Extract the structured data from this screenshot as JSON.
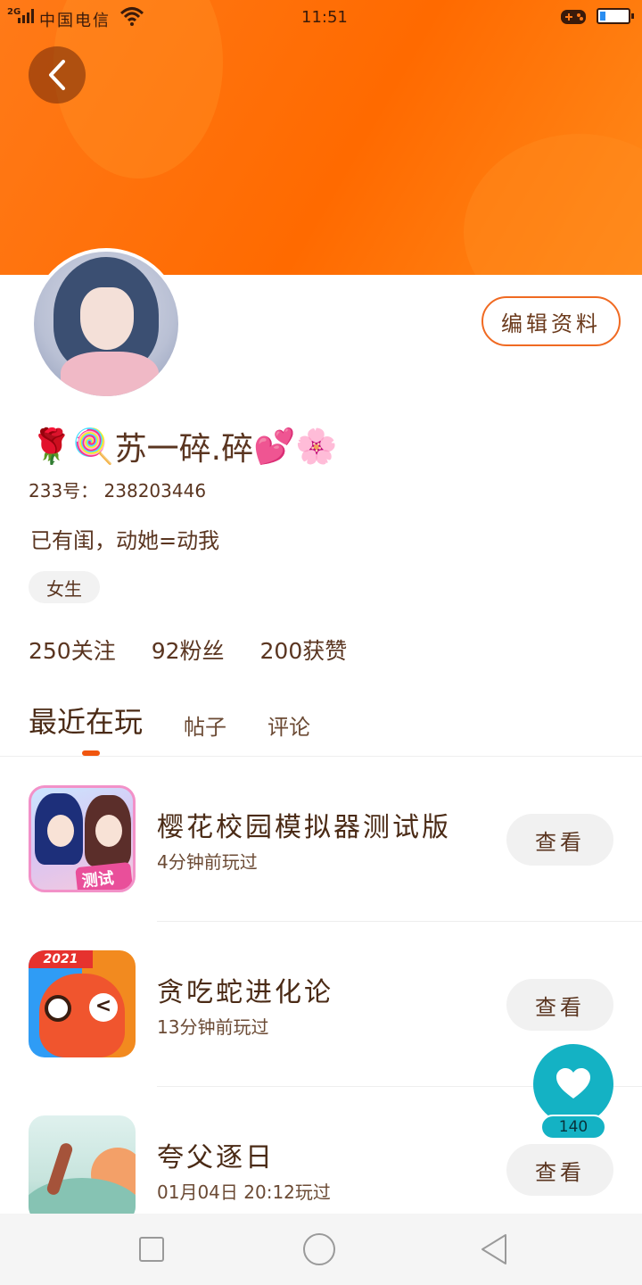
{
  "status_bar": {
    "network": "2G",
    "carrier": "中国电信",
    "time": "11:51",
    "battery_level": 0.15,
    "icons": [
      "signal-icon",
      "wifi-icon",
      "gamepad-icon",
      "battery-icon"
    ]
  },
  "header": {
    "back_icon": "back-arrow-icon",
    "colors": {
      "accent": "#ff6a00",
      "tab_indicator": "#f0560f",
      "fab": "#14b2c4"
    }
  },
  "profile": {
    "edit_label": "编辑资料",
    "nickname_emoji_left": "🌹🍭",
    "nickname_text": "苏一碎.碎",
    "nickname_emoji_right": "💕🌸",
    "uid": "233号： 238203446",
    "bio": "已有闺，动她=动我",
    "gender_tag": "女生",
    "stats": {
      "following": "250关注",
      "fans": "92粉丝",
      "likes": "200获赞"
    }
  },
  "tabs": [
    {
      "label": "最近在玩",
      "active": true
    },
    {
      "label": "帖子",
      "active": false
    },
    {
      "label": "评论",
      "active": false
    }
  ],
  "games": [
    {
      "title": "樱花校园模拟器测试版",
      "time": "4分钟前玩过",
      "button": "查看",
      "icon_badge": "测试版"
    },
    {
      "title": "贪吃蛇进化论",
      "time": "13分钟前玩过",
      "button": "查看",
      "icon_badge": "2021"
    },
    {
      "title": "夸父逐日",
      "time": "01月04日 20:12玩过",
      "button": "查看"
    }
  ],
  "fab": {
    "icon": "heart-icon",
    "count": "140"
  },
  "nav_bar": {
    "icons": [
      "recent-apps-icon",
      "home-icon",
      "back-icon"
    ]
  }
}
